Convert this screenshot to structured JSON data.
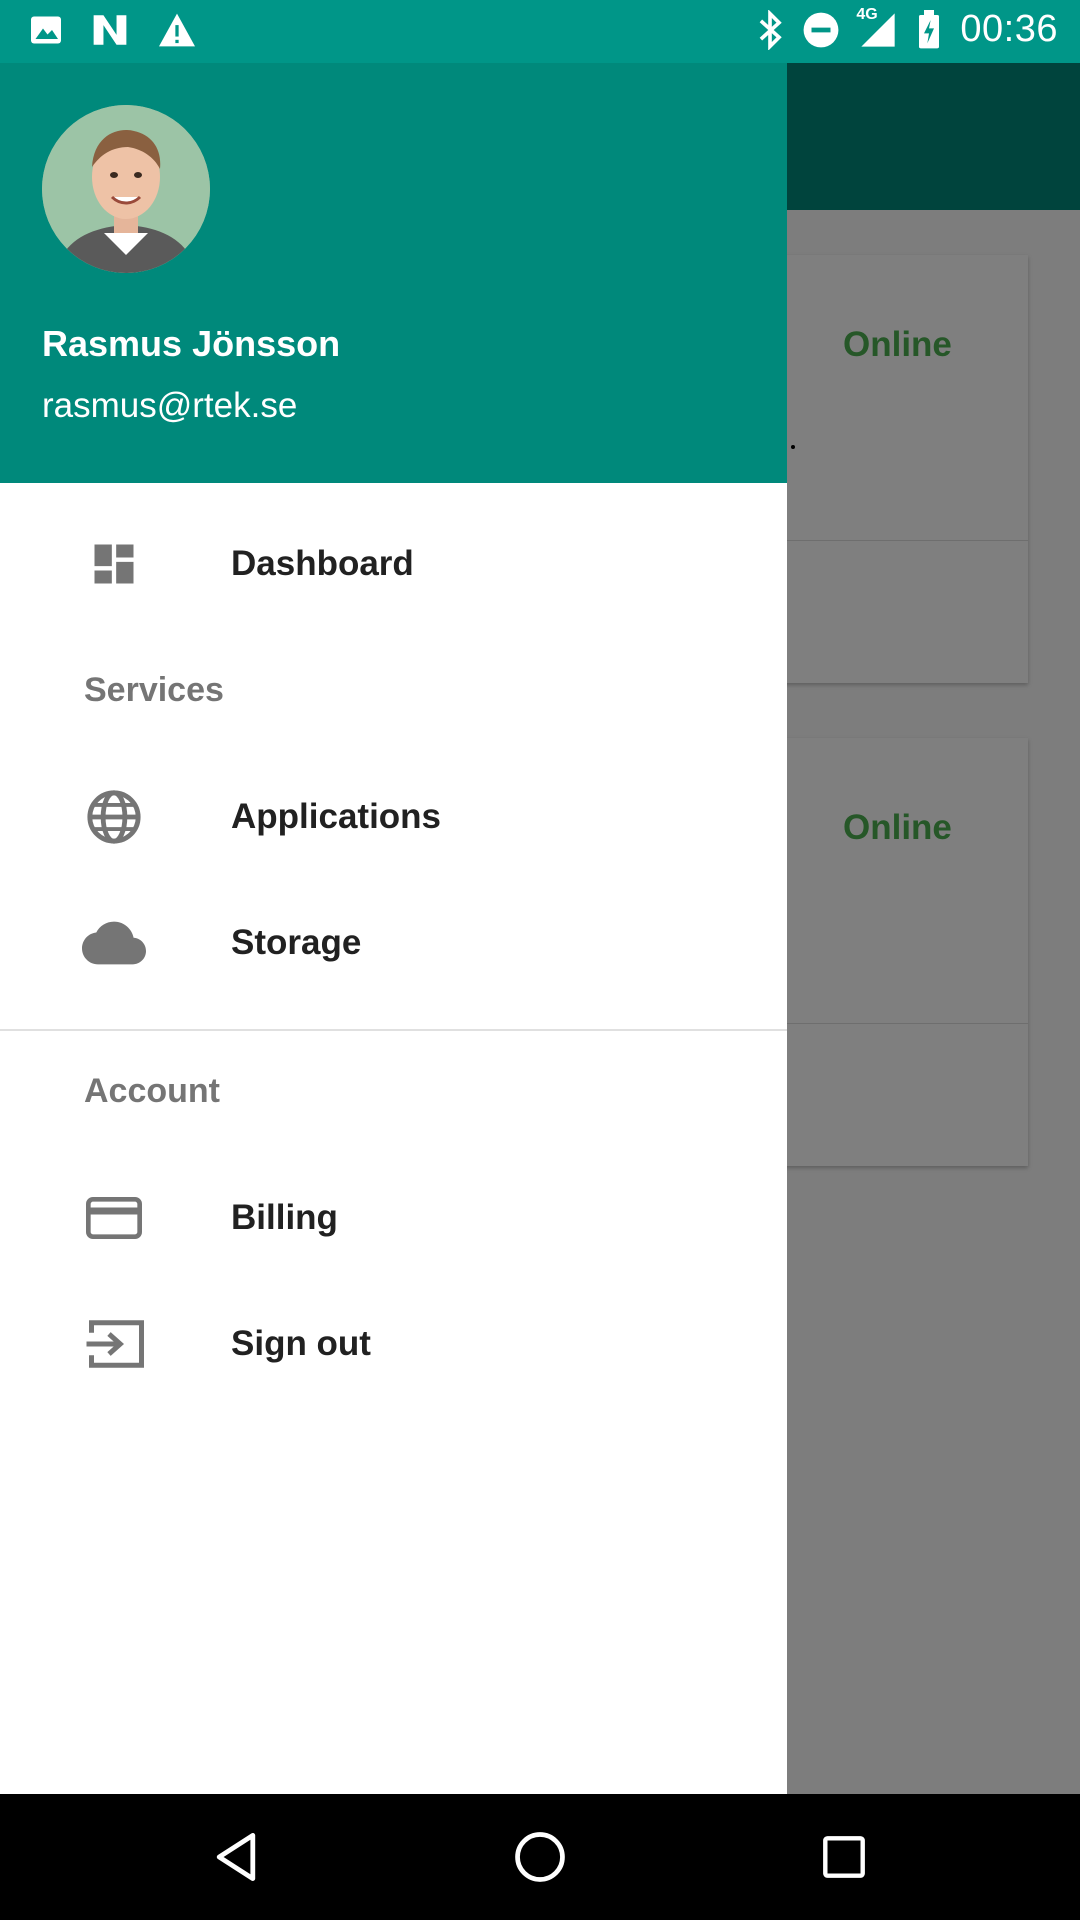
{
  "status_bar": {
    "time": "00:36",
    "network": "4G",
    "left_icons": [
      "image-icon",
      "n-app-icon",
      "warning-icon"
    ],
    "right_icons": [
      "bluetooth-icon",
      "do-not-disturb-icon",
      "signal-icon",
      "battery-charging-icon"
    ]
  },
  "drawer": {
    "user": {
      "name": "Rasmus Jönsson",
      "email": "rasmus@rtek.se"
    },
    "items": [
      {
        "label": "Dashboard",
        "icon": "dashboard-icon"
      },
      {
        "label": "Applications",
        "icon": "globe-icon"
      },
      {
        "label": "Storage",
        "icon": "cloud-icon"
      },
      {
        "label": "Billing",
        "icon": "credit-card-icon"
      },
      {
        "label": "Sign out",
        "icon": "sign-out-icon"
      }
    ],
    "sections": {
      "services": "Services",
      "account": "Account"
    }
  },
  "background": {
    "cards": [
      {
        "status": "Online"
      },
      {
        "status": "Online"
      }
    ]
  },
  "colors": {
    "primary": "#009688",
    "primary_dark": "#00897b",
    "status_online": "#4caf50",
    "icon_gray": "#757575"
  },
  "nav_bar": {
    "buttons": [
      "back-icon",
      "home-icon",
      "recents-icon"
    ]
  }
}
